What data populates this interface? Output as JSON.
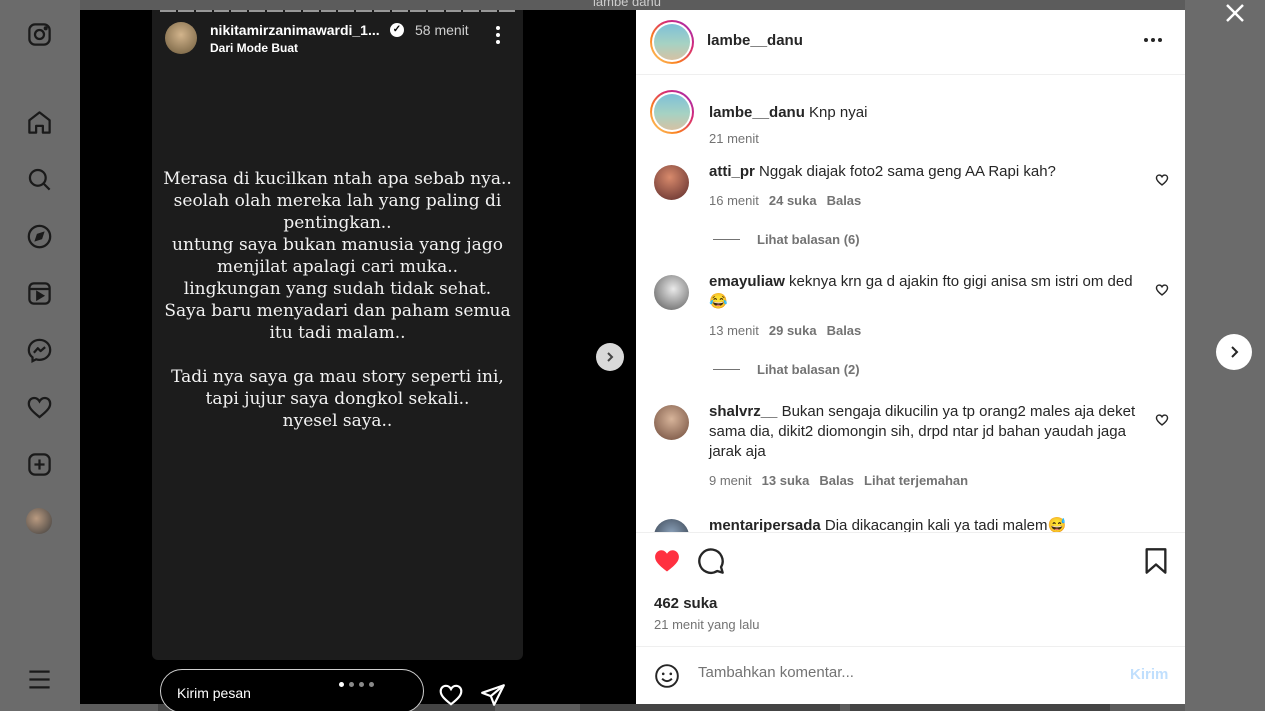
{
  "background": {
    "peek_text": "lambe danu"
  },
  "sidebar": {
    "items": [
      {
        "name": "instagram-icon"
      },
      {
        "name": "home-icon"
      },
      {
        "name": "search-icon"
      },
      {
        "name": "explore-icon"
      },
      {
        "name": "reels-icon"
      },
      {
        "name": "messenger-icon"
      },
      {
        "name": "heart-icon"
      },
      {
        "name": "create-icon"
      },
      {
        "name": "profile-avatar"
      },
      {
        "name": "menu-icon"
      }
    ]
  },
  "story": {
    "username": "nikitamirzanimawardi_1...",
    "time": "58 menit",
    "subtitle": "Dari Mode Buat",
    "text": "Merasa di kucilkan ntah apa sebab nya..\nseolah olah mereka lah yang paling di\npentingkan..\nuntung saya bukan manusia yang jago\nmenjilat apalagi cari muka..\nlingkungan yang sudah tidak sehat.\nSaya baru menyadari dan paham semua\nitu tadi malam..\n\nTadi nya saya ga mau story seperti ini,\ntapi jujur saya dongkol sekali..\nnyesel saya..",
    "reply_placeholder": "Kirim pesan",
    "dot_count": 4,
    "active_dot": 0
  },
  "post": {
    "author": "lambe__danu",
    "caption": {
      "user": "lambe__danu",
      "text": "Knp nyai",
      "time": "21 menit"
    },
    "comments": [
      {
        "user": "atti_pr",
        "text": "Nggak diajak foto2 sama geng AA Rapi kah?",
        "time": "16 menit",
        "likes": "24 suka",
        "reply": "Balas",
        "translate": "",
        "view_replies": "Lihat balasan (6)"
      },
      {
        "user": "emayuliaw",
        "text": "keknya krn ga d ajakin fto gigi anisa sm istri om ded 😂",
        "time": "13 menit",
        "likes": "29 suka",
        "reply": "Balas",
        "translate": "",
        "view_replies": "Lihat balasan (2)"
      },
      {
        "user": "shalvrz__",
        "text": "Bukan sengaja dikucilin ya tp orang2 males aja deket sama dia, dikit2 diomongin sih, drpd ntar jd bahan yaudah jaga jarak aja",
        "time": "9 menit",
        "likes": "13 suka",
        "reply": "Balas",
        "translate": "Lihat terjemahan",
        "view_replies": ""
      },
      {
        "user": "mentaripersada",
        "text": "Dia dikacangin kali ya tadi malem😅",
        "time": "",
        "likes": "",
        "reply": "",
        "translate": "",
        "view_replies": ""
      }
    ],
    "likes": "462 suka",
    "posted": "21 menit yang lalu",
    "add_comment_placeholder": "Tambahkan komentar...",
    "post_button": "Kirim",
    "liked": true,
    "colors": {
      "like_red": "#ff3040",
      "link_blue": "#c0dffd",
      "muted": "#737373"
    }
  }
}
